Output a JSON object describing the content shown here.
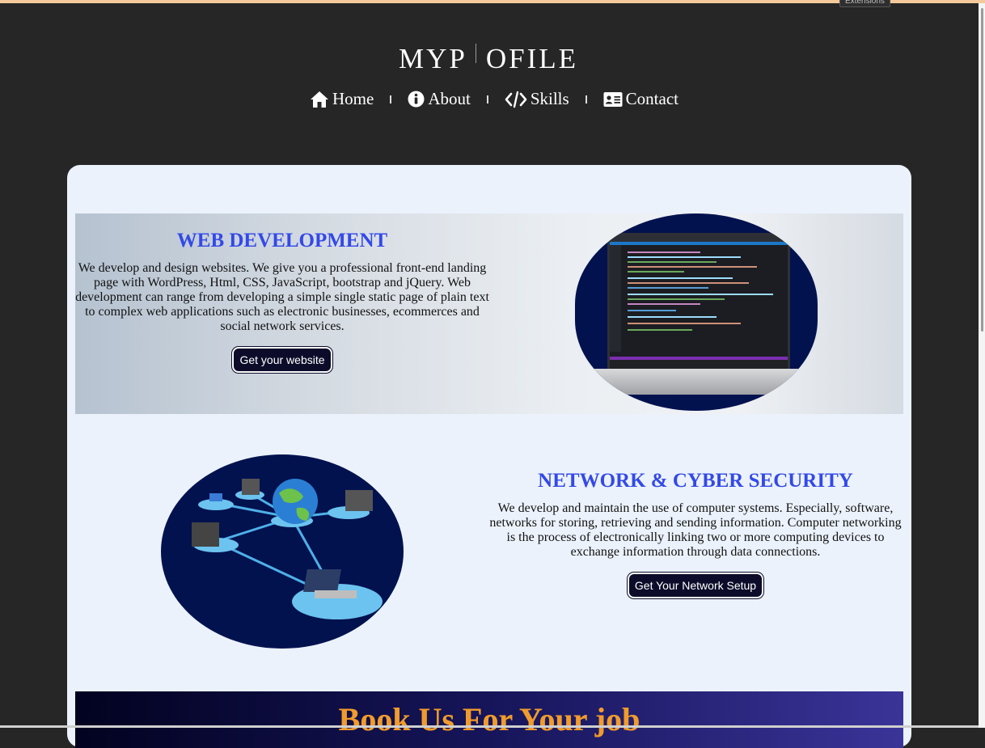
{
  "browser": {
    "extensions_tooltip": "Extensions"
  },
  "site": {
    "logo_left": "MYP",
    "logo_right": "OFILE"
  },
  "nav": {
    "items": [
      {
        "label": "Home",
        "icon": "home-icon"
      },
      {
        "label": "About",
        "icon": "info-icon"
      },
      {
        "label": "Skills",
        "icon": "code-icon"
      },
      {
        "label": "Contact",
        "icon": "address-card-icon"
      }
    ]
  },
  "web_dev": {
    "title": "WEB DEVELOPMENT",
    "description": "We develop and design websites. We give you a professional front-end landing page with WordPress, Html, CSS, JavaScript, bootstrap and jQuery. Web development can range from developing a simple single static page of plain text to complex web applications such as electronic businesses, ecommerces and social network services.",
    "button": "Get your website",
    "image": "laptop-code-editor-image"
  },
  "network": {
    "title": "NETWORK & CYBER SECURITY",
    "description": "We develop and maintain the use of computer systems. Especially, software, networks for storing, retrieving and sending information. Computer networking is the process of electronically linking two or more computing devices to exchange information through data connections.",
    "button": "Get Your Network Setup",
    "image": "network-globe-servers-image"
  },
  "banner": {
    "title": "Book Us For Your job"
  },
  "colors": {
    "page_background": "#262626",
    "card_background": "#ebf2fb",
    "section_title": "#3349e8",
    "button_background": "#0c0c2a",
    "image_blob": "#02124f",
    "banner_title": "#f09b2c"
  }
}
